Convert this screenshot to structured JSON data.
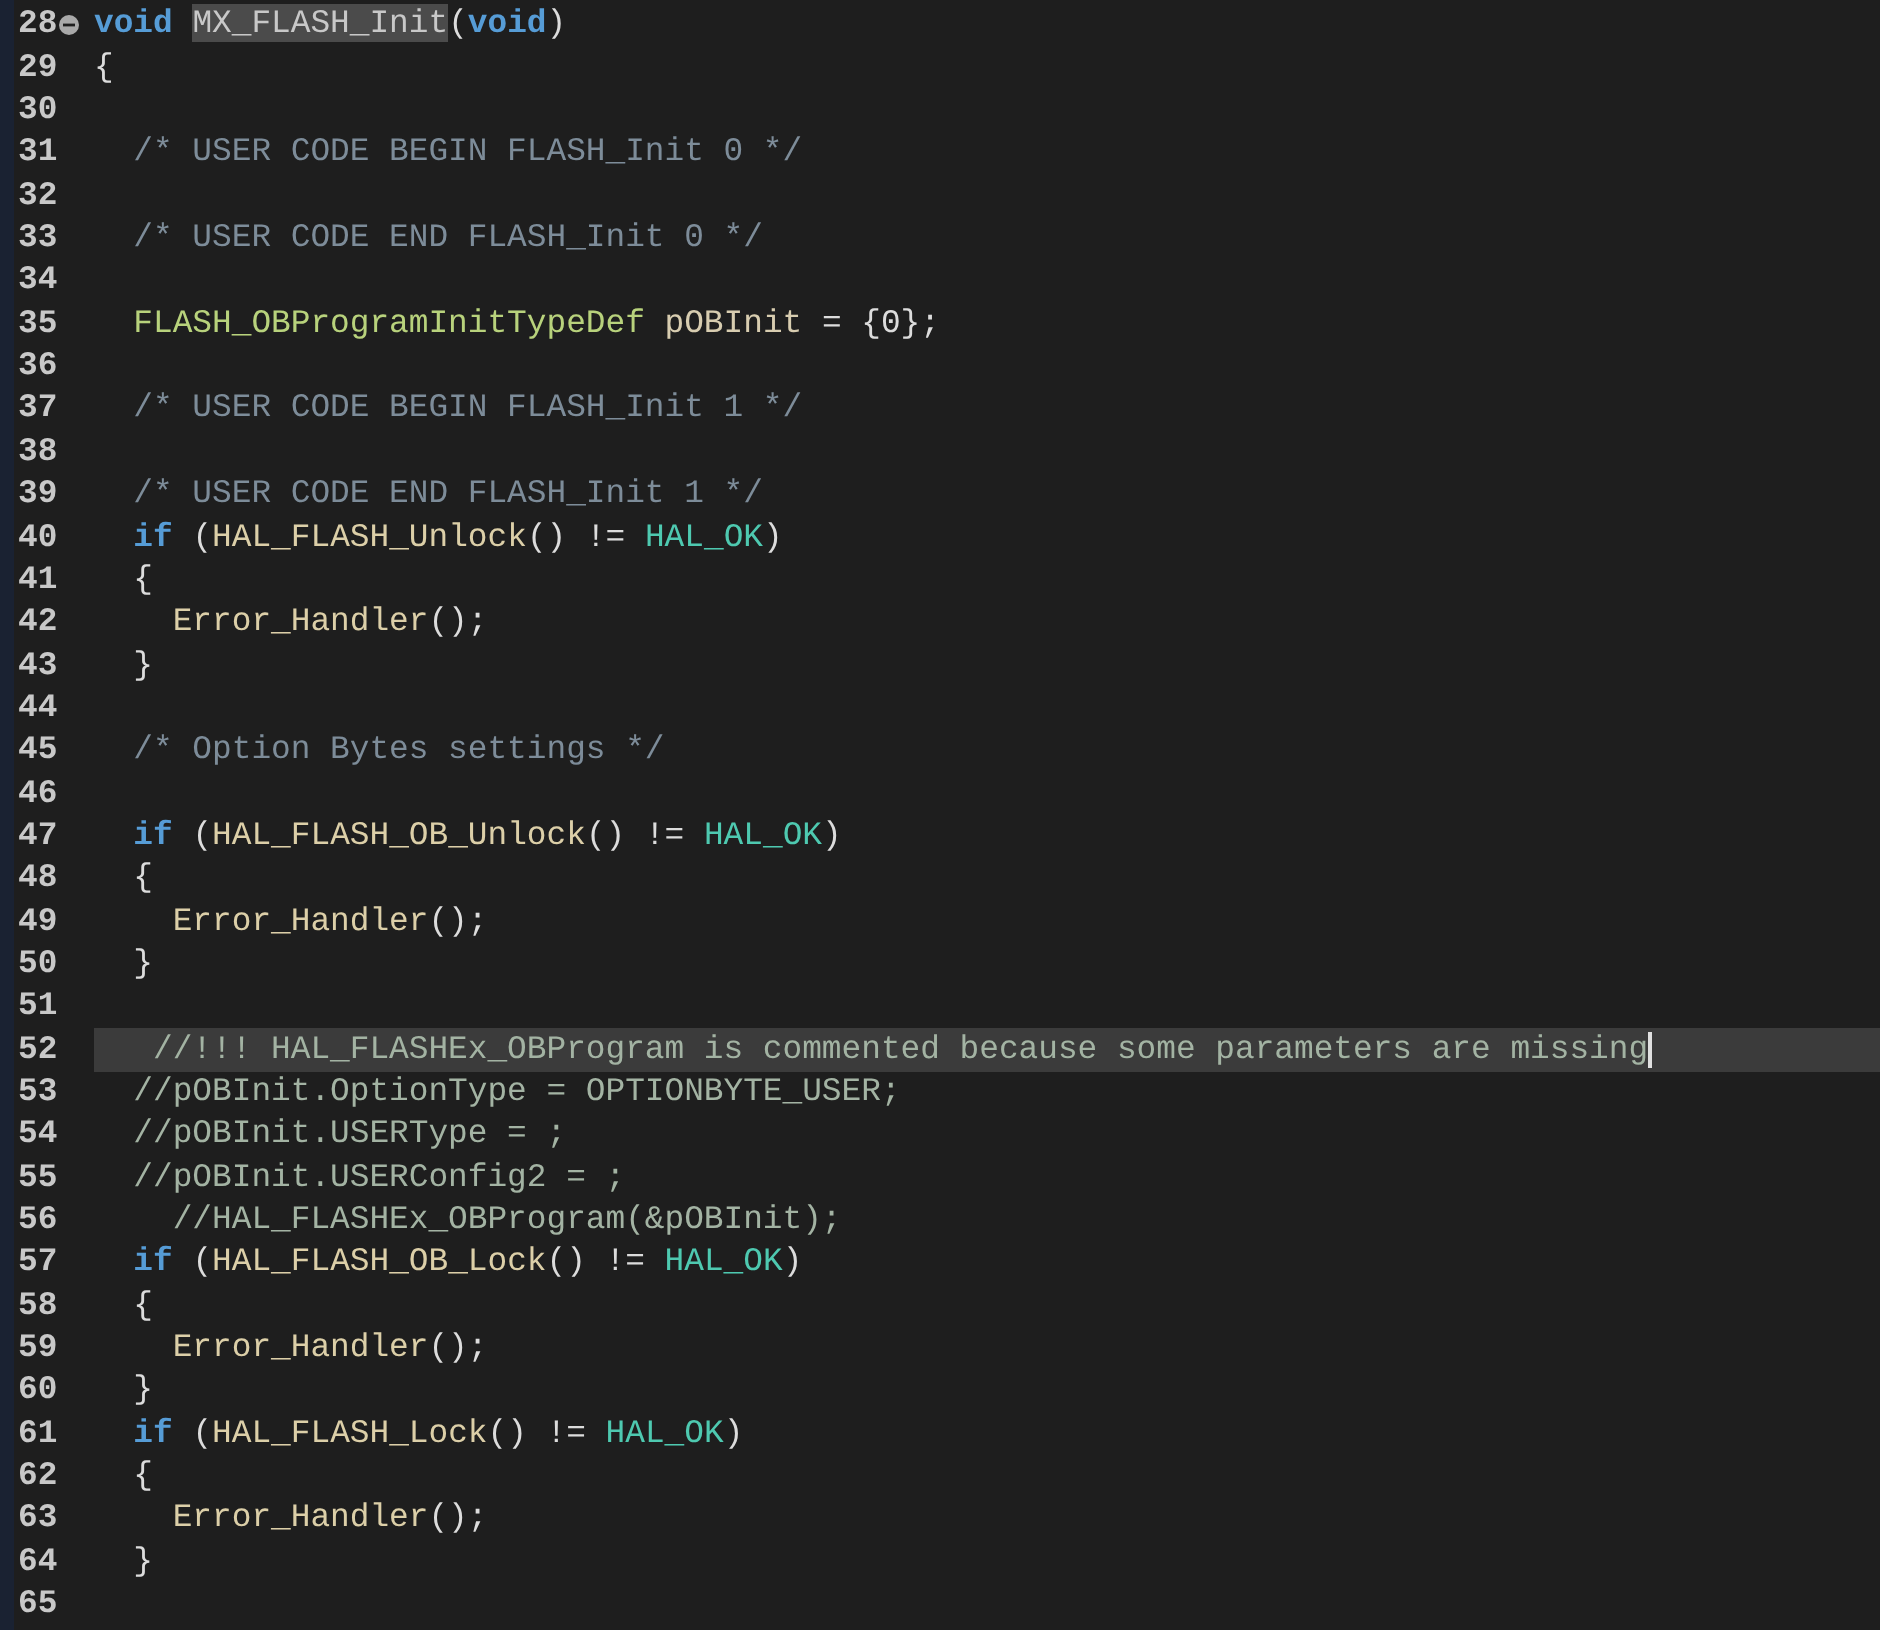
{
  "editor": {
    "lines": [
      {
        "number": "28",
        "current": false,
        "foldable": true,
        "tokens": [
          {
            "text": "void ",
            "kind": "keyword"
          },
          {
            "text": "MX_FLASH_Init",
            "kind": "match"
          },
          {
            "text": "(",
            "kind": "plain"
          },
          {
            "text": "void",
            "kind": "keyword"
          },
          {
            "text": ")",
            "kind": "plain"
          }
        ]
      },
      {
        "number": "29",
        "current": false,
        "foldable": false,
        "tokens": [
          {
            "text": "{",
            "kind": "plain"
          }
        ]
      },
      {
        "number": "30",
        "current": false,
        "foldable": false
      },
      {
        "number": "31",
        "current": false,
        "foldable": false,
        "tokens": [
          {
            "text": "  /* USER CODE BEGIN FLASH_Init 0 */",
            "kind": "comment"
          }
        ]
      },
      {
        "number": "32",
        "current": false,
        "foldable": false
      },
      {
        "number": "33",
        "current": false,
        "foldable": false,
        "tokens": [
          {
            "text": "  /* USER CODE END FLASH_Init 0 */",
            "kind": "comment"
          }
        ]
      },
      {
        "number": "34",
        "current": false,
        "foldable": false
      },
      {
        "number": "35",
        "current": false,
        "foldable": false,
        "tokens": [
          {
            "text": "  FLASH_OBProgramInitTypeDef",
            "kind": "type"
          },
          {
            "text": " pOBInit ",
            "kind": "variable"
          },
          {
            "text": "= {0};",
            "kind": "plain"
          }
        ]
      },
      {
        "number": "36",
        "current": false,
        "foldable": false
      },
      {
        "number": "37",
        "current": false,
        "foldable": false,
        "tokens": [
          {
            "text": "  /* USER CODE BEGIN FLASH_Init 1 */",
            "kind": "comment"
          }
        ]
      },
      {
        "number": "38",
        "current": false,
        "foldable": false
      },
      {
        "number": "39",
        "current": false,
        "foldable": false,
        "tokens": [
          {
            "text": "  /* USER CODE END FLASH_Init 1 */",
            "kind": "comment"
          }
        ]
      },
      {
        "number": "40",
        "current": false,
        "foldable": false,
        "tokens": [
          {
            "text": "  if",
            "kind": "keyword"
          },
          {
            "text": " (",
            "kind": "plain"
          },
          {
            "text": "HAL_FLASH_Unlock",
            "kind": "function"
          },
          {
            "text": "() != ",
            "kind": "plain"
          },
          {
            "text": "HAL_OK",
            "kind": "macro"
          },
          {
            "text": ")",
            "kind": "plain"
          }
        ]
      },
      {
        "number": "41",
        "current": false,
        "foldable": false,
        "tokens": [
          {
            "text": "  {",
            "kind": "plain"
          }
        ]
      },
      {
        "number": "42",
        "current": false,
        "foldable": false,
        "tokens": [
          {
            "text": "    Error_Handler",
            "kind": "function"
          },
          {
            "text": "();",
            "kind": "plain"
          }
        ]
      },
      {
        "number": "43",
        "current": false,
        "foldable": false,
        "tokens": [
          {
            "text": "  }",
            "kind": "plain"
          }
        ]
      },
      {
        "number": "44",
        "current": false,
        "foldable": false
      },
      {
        "number": "45",
        "current": false,
        "foldable": false,
        "tokens": [
          {
            "text": "  /* Option Bytes settings */",
            "kind": "comment"
          }
        ]
      },
      {
        "number": "46",
        "current": false,
        "foldable": false
      },
      {
        "number": "47",
        "current": false,
        "foldable": false,
        "tokens": [
          {
            "text": "  if",
            "kind": "keyword"
          },
          {
            "text": " (",
            "kind": "plain"
          },
          {
            "text": "HAL_FLASH_OB_Unlock",
            "kind": "function"
          },
          {
            "text": "() != ",
            "kind": "plain"
          },
          {
            "text": "HAL_OK",
            "kind": "macro"
          },
          {
            "text": ")",
            "kind": "plain"
          }
        ]
      },
      {
        "number": "48",
        "current": false,
        "foldable": false,
        "tokens": [
          {
            "text": "  {",
            "kind": "plain"
          }
        ]
      },
      {
        "number": "49",
        "current": false,
        "foldable": false,
        "tokens": [
          {
            "text": "    Error_Handler",
            "kind": "function"
          },
          {
            "text": "();",
            "kind": "plain"
          }
        ]
      },
      {
        "number": "50",
        "current": false,
        "foldable": false,
        "tokens": [
          {
            "text": "  }",
            "kind": "plain"
          }
        ]
      },
      {
        "number": "51",
        "current": false,
        "foldable": false
      },
      {
        "number": "52",
        "current": true,
        "foldable": false,
        "tokens": [
          {
            "text": "   //!!! HAL_FLASHEx_OBProgram is commented because some parameters are missing",
            "kind": "line_comment"
          }
        ]
      },
      {
        "number": "53",
        "current": false,
        "foldable": false,
        "tokens": [
          {
            "text": "  //pOBInit.OptionType = OPTIONBYTE_USER;",
            "kind": "line_comment"
          }
        ]
      },
      {
        "number": "54",
        "current": false,
        "foldable": false,
        "tokens": [
          {
            "text": "  //pOBInit.USERType = ;",
            "kind": "line_comment"
          }
        ]
      },
      {
        "number": "55",
        "current": false,
        "foldable": false,
        "tokens": [
          {
            "text": "  //pOBInit.USERConfig2 = ;",
            "kind": "line_comment"
          }
        ]
      },
      {
        "number": "56",
        "current": false,
        "foldable": false,
        "tokens": [
          {
            "text": "    //HAL_FLASHEx_OBProgram(&pOBInit);",
            "kind": "line_comment"
          }
        ]
      },
      {
        "number": "57",
        "current": false,
        "foldable": false,
        "tokens": [
          {
            "text": "  if",
            "kind": "keyword"
          },
          {
            "text": " (",
            "kind": "plain"
          },
          {
            "text": "HAL_FLASH_OB_Lock",
            "kind": "function"
          },
          {
            "text": "() != ",
            "kind": "plain"
          },
          {
            "text": "HAL_OK",
            "kind": "macro"
          },
          {
            "text": ")",
            "kind": "plain"
          }
        ]
      },
      {
        "number": "58",
        "current": false,
        "foldable": false,
        "tokens": [
          {
            "text": "  {",
            "kind": "plain"
          }
        ]
      },
      {
        "number": "59",
        "current": false,
        "foldable": false,
        "tokens": [
          {
            "text": "    Error_Handler",
            "kind": "function"
          },
          {
            "text": "();",
            "kind": "plain"
          }
        ]
      },
      {
        "number": "60",
        "current": false,
        "foldable": false,
        "tokens": [
          {
            "text": "  }",
            "kind": "plain"
          }
        ]
      },
      {
        "number": "61",
        "current": false,
        "foldable": false,
        "tokens": [
          {
            "text": "  if",
            "kind": "keyword"
          },
          {
            "text": " (",
            "kind": "plain"
          },
          {
            "text": "HAL_FLASH_Lock",
            "kind": "function"
          },
          {
            "text": "() != ",
            "kind": "plain"
          },
          {
            "text": "HAL_OK",
            "kind": "macro"
          },
          {
            "text": ")",
            "kind": "plain"
          }
        ]
      },
      {
        "number": "62",
        "current": false,
        "foldable": false,
        "tokens": [
          {
            "text": "  {",
            "kind": "plain"
          }
        ]
      },
      {
        "number": "63",
        "current": false,
        "foldable": false,
        "tokens": [
          {
            "text": "    Error_Handler",
            "kind": "function"
          },
          {
            "text": "();",
            "kind": "plain"
          }
        ]
      },
      {
        "number": "64",
        "current": false,
        "foldable": false,
        "tokens": [
          {
            "text": "  }",
            "kind": "plain"
          }
        ]
      },
      {
        "number": "65",
        "current": false,
        "foldable": false
      }
    ]
  }
}
